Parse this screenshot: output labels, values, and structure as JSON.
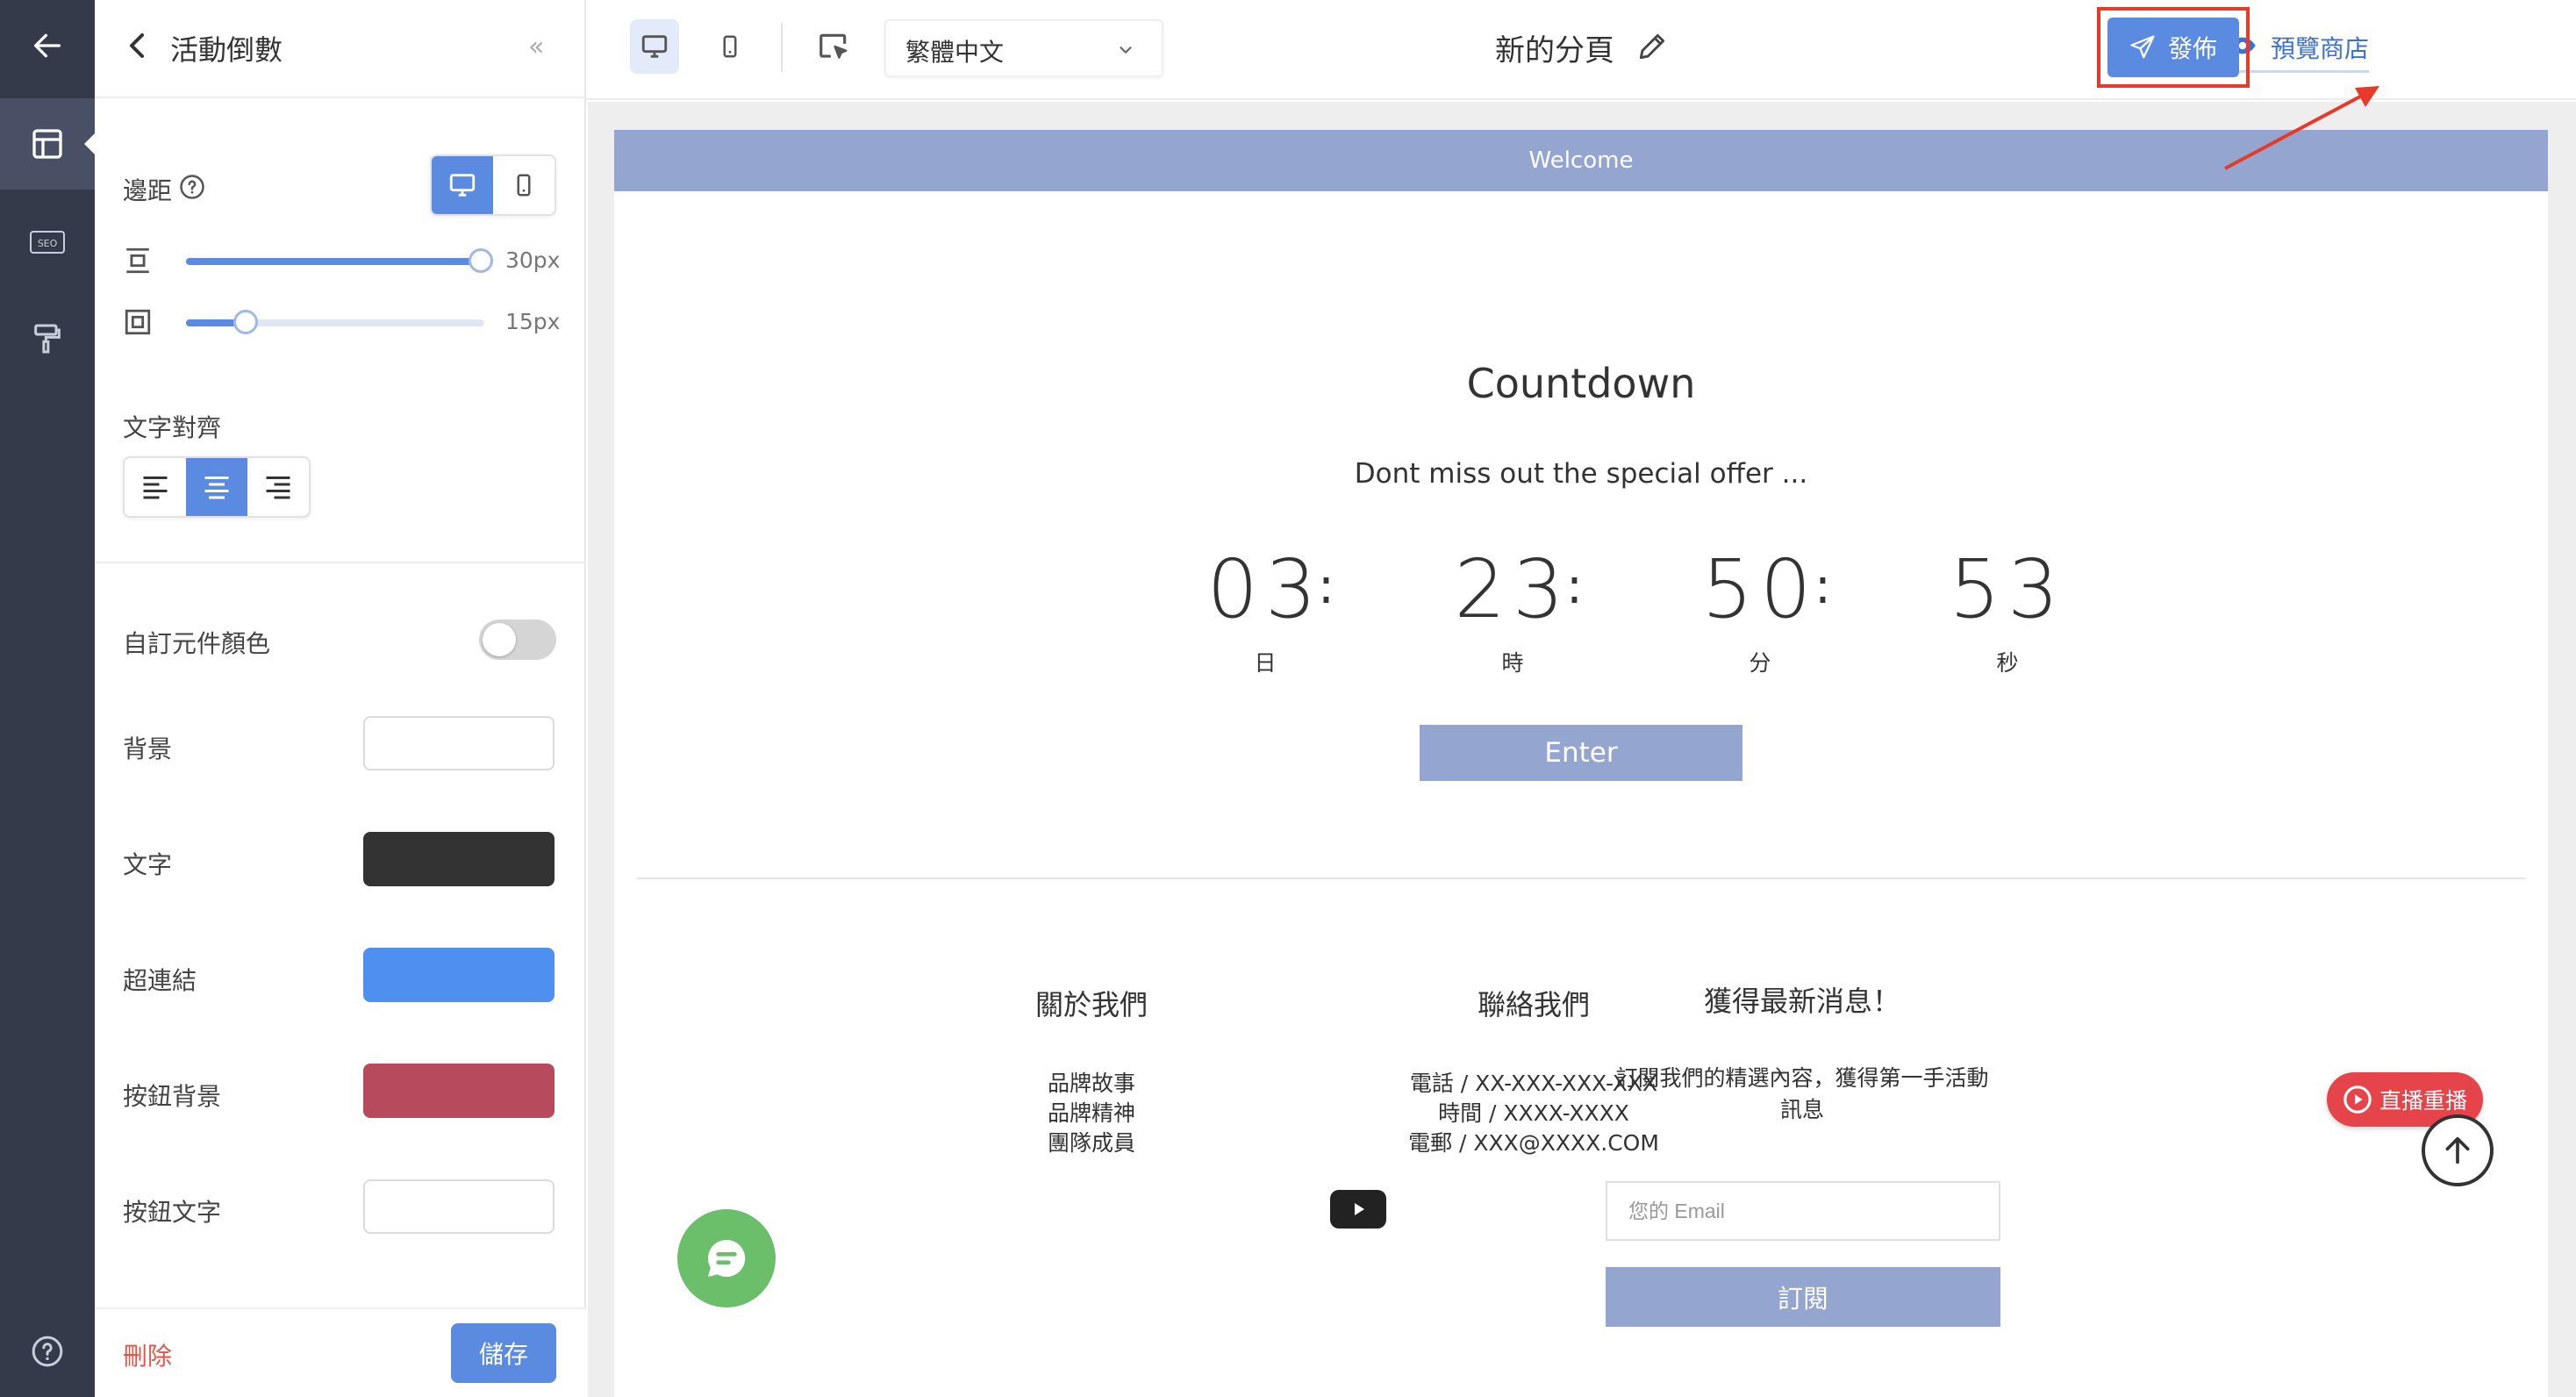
{
  "panel": {
    "title": "活動倒數",
    "collapse_glyph": "«",
    "padding_label": "邊距",
    "padding_vertical_value": "30px",
    "padding_horizontal_value": "15px",
    "text_align_label": "文字對齊",
    "custom_color_label": "自訂元件顏色",
    "colors": [
      {
        "label": "背景",
        "hex": "#ffffff"
      },
      {
        "label": "文字",
        "hex": "#333333"
      },
      {
        "label": "超連結",
        "hex": "#4f8ff0"
      },
      {
        "label": "按鈕背景",
        "hex": "#b84a5e"
      },
      {
        "label": "按鈕文字",
        "hex": "#ffffff"
      }
    ],
    "delete_label": "刪除",
    "save_label": "儲存"
  },
  "topbar": {
    "language": "繁體中文",
    "page_title": "新的分頁",
    "preview_label": "預覽商店",
    "publish_label": "發佈"
  },
  "page": {
    "welcome": "Welcome",
    "countdown_title": "Countdown",
    "countdown_subtitle": "Dont miss out the special offer ...",
    "countdown": [
      {
        "value": "03",
        "unit": "日"
      },
      {
        "value": "23",
        "unit": "時"
      },
      {
        "value": "50",
        "unit": "分"
      },
      {
        "value": "53",
        "unit": "秒"
      }
    ],
    "colon": ":",
    "enter_label": "Enter",
    "footer": {
      "about_title": "關於我們",
      "about_links": [
        "品牌故事",
        "品牌精神",
        "團隊成員"
      ],
      "contact_title": "聯絡我們",
      "contact_lines": [
        "電話 / XX-XXX-XXX-XXX",
        "時間 / XXXX-XXXX",
        "電郵 / XXX@XXXX.COM"
      ],
      "news_title": "獲得最新消息！",
      "news_desc_line1": "訂閱我們的精選內容，獲得第一手活動",
      "news_desc_line2": "訊息",
      "email_placeholder": "您的 Email",
      "subscribe_label": "訂閱"
    },
    "live_replay_label": "直播重播"
  },
  "colors": {
    "accent": "#5b8be0",
    "rail": "#343a4a",
    "page_theme": "#94a6cf",
    "annotation": "#e83a2a"
  },
  "icons": [
    "arrow-left-icon",
    "layout-icon",
    "seo-icon",
    "paint-roller-icon",
    "help-icon",
    "chevron-left-icon",
    "desktop-icon",
    "mobile-icon",
    "cursor-select-icon",
    "chevron-down-icon",
    "pencil-icon",
    "eye-icon",
    "send-icon",
    "chat-icon",
    "play-icon",
    "arrow-up-icon",
    "youtube-icon"
  ]
}
